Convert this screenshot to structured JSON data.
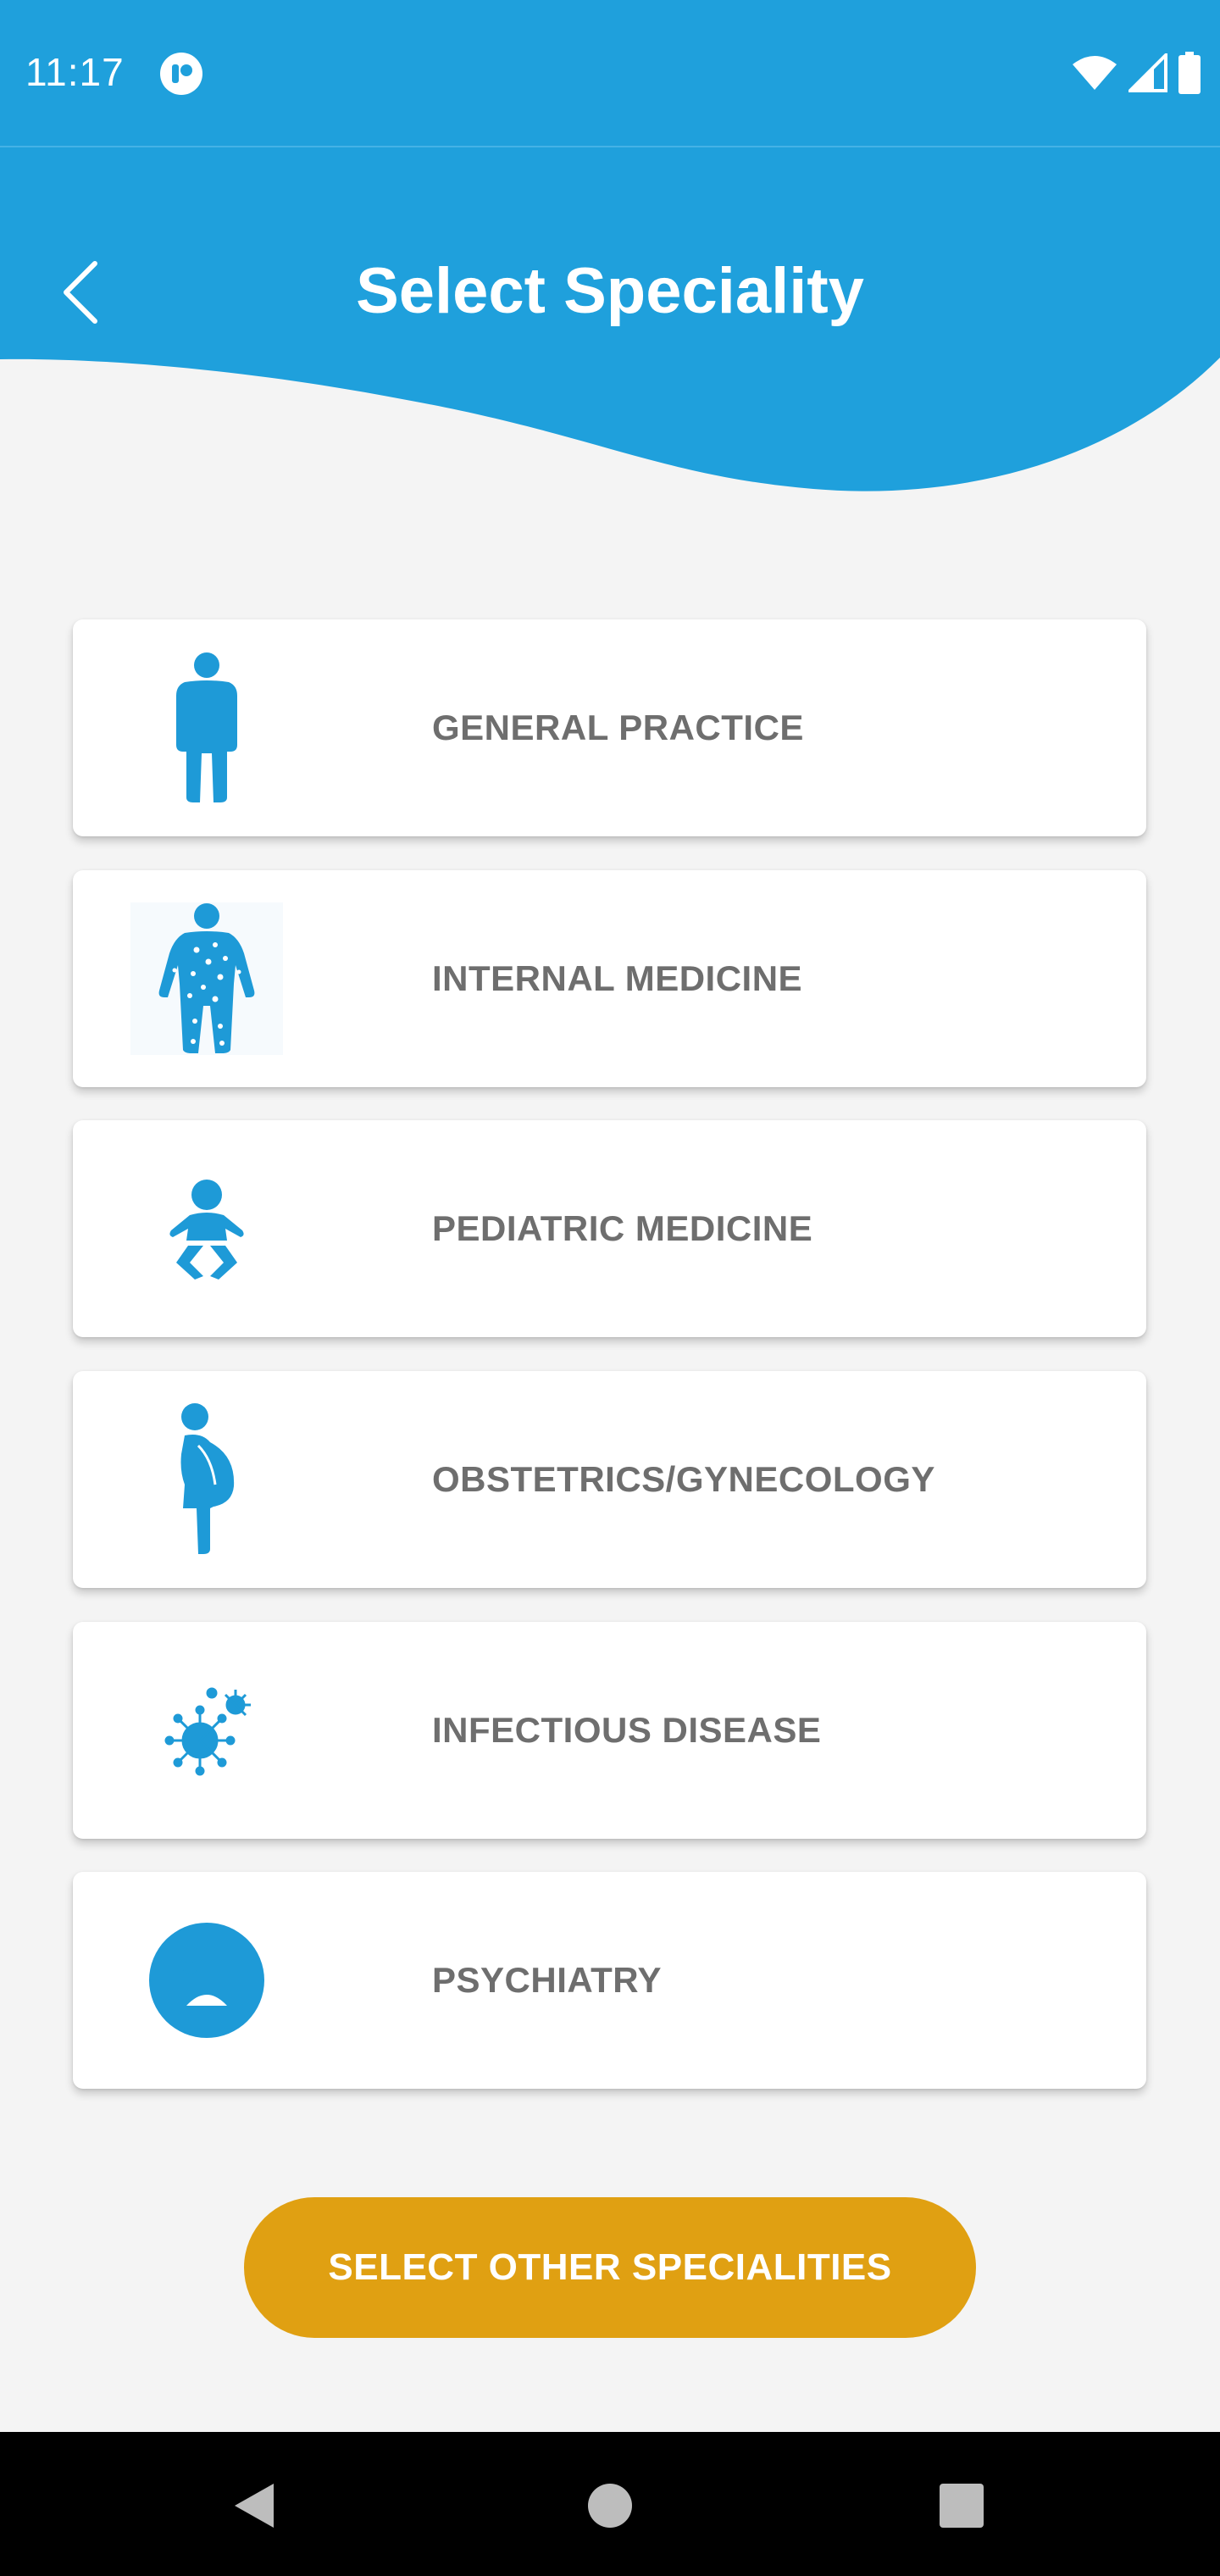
{
  "status_bar": {
    "time": "11:17",
    "icons": [
      "app-notification-icon",
      "wifi-icon",
      "cellular-signal-icon",
      "battery-icon"
    ]
  },
  "header": {
    "title": "Select Speciality",
    "back_icon": "chevron-left-icon",
    "background_color": "#1fa0dc"
  },
  "specialities": [
    {
      "label": "GENERAL PRACTICE",
      "icon": "person-icon"
    },
    {
      "label": "INTERNAL MEDICINE",
      "icon": "body-dots-icon"
    },
    {
      "label": "PEDIATRIC MEDICINE",
      "icon": "baby-icon"
    },
    {
      "label": "OBSTETRICS/GYNECOLOGY",
      "icon": "pregnant-woman-icon"
    },
    {
      "label": "INFECTIOUS DISEASE",
      "icon": "virus-icon"
    },
    {
      "label": "PSYCHIATRY",
      "icon": "sad-face-icon"
    }
  ],
  "cta": {
    "label": "SELECT OTHER SPECIALITIES",
    "color": "#e0a012"
  },
  "colors": {
    "accent": "#1fa0dc",
    "label_text": "#6e6e6e",
    "page_background": "#f4f4f4"
  },
  "nav_bar": {
    "icons": [
      "back-triangle-icon",
      "home-circle-icon",
      "recents-square-icon"
    ]
  }
}
